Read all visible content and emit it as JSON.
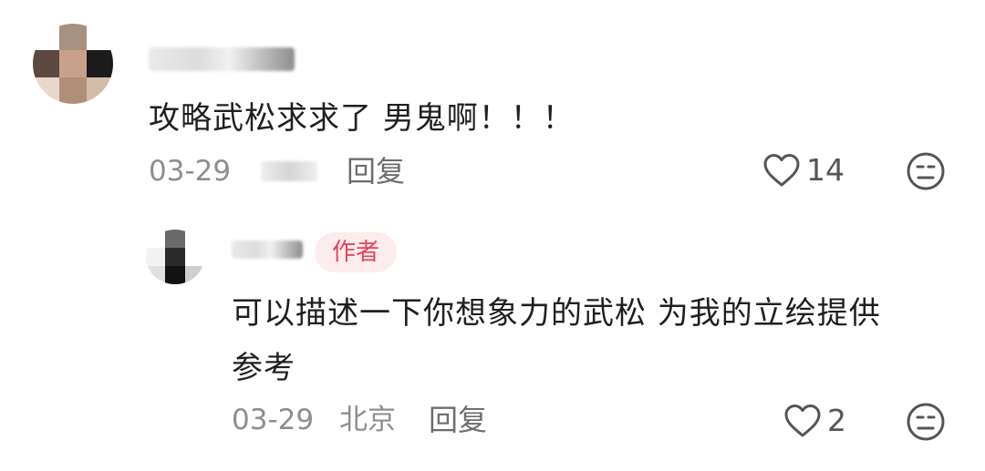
{
  "comment": {
    "text": "攻略武松求求了 男鬼啊！！！",
    "date": "03-29",
    "reply_label": "回复",
    "like_count": "14",
    "icons": {
      "like": "heart-outline-icon",
      "dislike": "neutral-face-icon"
    }
  },
  "reply": {
    "badge": "作者",
    "text_line1": "可以描述一下你想象力的武松 为我的立绘提供",
    "text_line2": "参考",
    "date": "03-29",
    "location": "北京",
    "reply_label": "回复",
    "like_count": "2",
    "icons": {
      "like": "heart-outline-icon",
      "dislike": "neutral-face-icon"
    }
  },
  "colors": {
    "text": "#1f1f1f",
    "meta": "#8e8e8e",
    "badge_bg": "#fdecee",
    "badge_text": "#e2435a"
  }
}
